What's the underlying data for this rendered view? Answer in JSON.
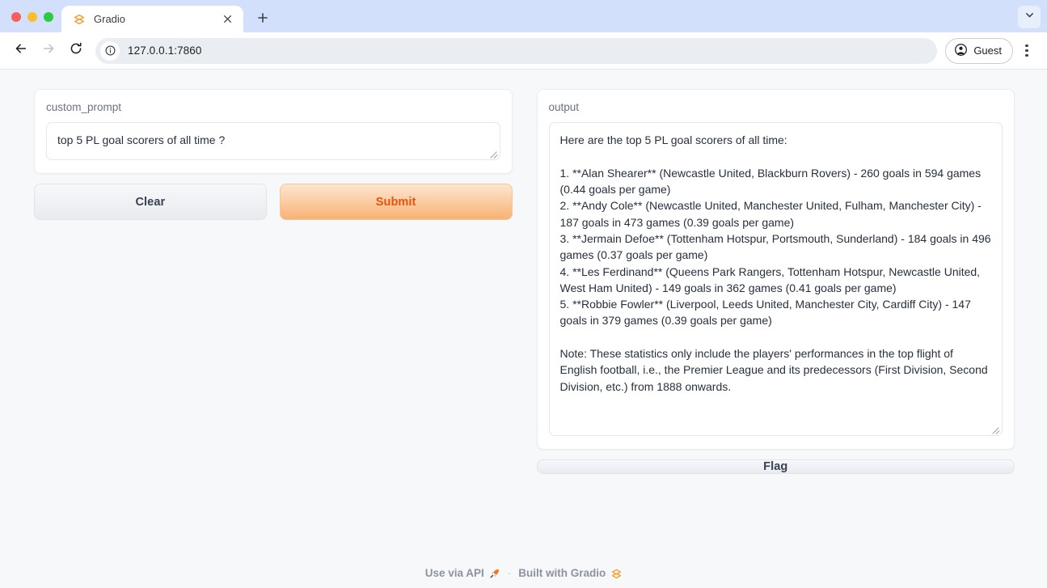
{
  "browser": {
    "tab": {
      "title": "Gradio",
      "favicon_icon": "gradio-logo-icon",
      "close_icon": "close-icon"
    },
    "new_tab_icon": "plus-icon",
    "tab_list_icon": "chevron-down-icon",
    "nav": {
      "back_icon": "arrow-left-icon",
      "forward_icon": "arrow-right-icon",
      "reload_icon": "reload-icon"
    },
    "omnibox": {
      "url": "127.0.0.1:7860",
      "site_info_icon": "info-circle-icon"
    },
    "profile": {
      "label": "Guest",
      "icon": "account-circle-icon"
    },
    "menu_icon": "kebab-menu-icon",
    "window_controls": {
      "close_color": "#f6605c",
      "minimize_color": "#f9bd2e",
      "maximize_color": "#2aca41"
    }
  },
  "app": {
    "input": {
      "label": "custom_prompt",
      "value": "top 5 PL goal scorers of all time ?",
      "placeholder": "",
      "resize_handle_icon": "resize-handle-icon"
    },
    "buttons": {
      "clear": "Clear",
      "submit": "Submit",
      "flag": "Flag"
    },
    "output": {
      "label": "output",
      "value": "Here are the top 5 PL goal scorers of all time:\n\n1. **Alan Shearer** (Newcastle United, Blackburn Rovers) - 260 goals in 594 games (0.44 goals per game)\n2. **Andy Cole** (Newcastle United, Manchester United, Fulham, Manchester City) - 187 goals in 473 games (0.39 goals per game)\n3. **Jermain Defoe** (Tottenham Hotspur, Portsmouth, Sunderland) - 184 goals in 496 games (0.37 goals per game)\n4. **Les Ferdinand** (Queens Park Rangers, Tottenham Hotspur, Newcastle United, West Ham United) - 149 goals in 362 games (0.41 goals per game)\n5. **Robbie Fowler** (Liverpool, Leeds United, Manchester City, Cardiff City) - 147 goals in 379 games (0.39 goals per game)\n\nNote: These statistics only include the players' performances in the top flight of English football, i.e., the Premier League and its predecessors (First Division, Second Division, etc.) from 1888 onwards.",
      "resize_handle_icon": "resize-handle-icon"
    }
  },
  "footer": {
    "use_via_api": "Use via API",
    "api_icon": "rocket-icon",
    "separator": "·",
    "built_with": "Built with Gradio",
    "gradio_icon": "gradio-logo-icon"
  },
  "colors": {
    "accent": "#e4530b",
    "primary_button_start": "#fde6d0",
    "primary_button_end": "#f8b274",
    "page_background": "#f7f8fa",
    "tabstrip": "#d2e0fb"
  }
}
